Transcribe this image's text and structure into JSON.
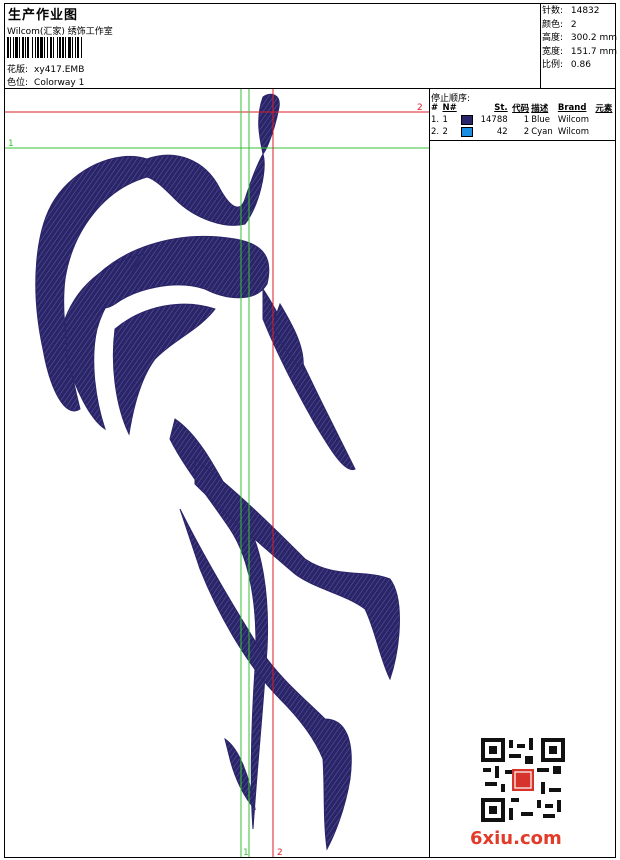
{
  "header": {
    "title": "生产作业图",
    "company": "Wilcom(汇家) 绣饰工作室",
    "design_label": "花版:",
    "design_value": "xy417.EMB",
    "colorway_label": "色位:",
    "colorway_value": "Colorway 1"
  },
  "stats": [
    {
      "label": "针数:",
      "value": "14832"
    },
    {
      "label": "颜色:",
      "value": "2"
    },
    {
      "label": "高度:",
      "value": "300.2 mm"
    },
    {
      "label": "宽度:",
      "value": "151.7 mm"
    },
    {
      "label": "比例:",
      "value": "0.86"
    }
  ],
  "color_table": {
    "title": "停止顺序:",
    "headers": [
      "#",
      "N#",
      "St.",
      "代码",
      "描述",
      "Brand",
      "元素"
    ],
    "rows": [
      {
        "idx": "1.",
        "num": "1",
        "color": "#2a2469",
        "stitches": "14788",
        "code": "1",
        "desc": "Blue",
        "brand": "Wilcom"
      },
      {
        "idx": "2.",
        "num": "2",
        "color": "#1a8ee0",
        "stitches": "42",
        "code": "2",
        "desc": "Cyan",
        "brand": "Wilcom"
      }
    ]
  },
  "guides": {
    "red_label_h": "2",
    "red_label_v": "2",
    "green_label_h": "1",
    "green_label_v": "1"
  },
  "colors": {
    "thread_blue": "#2a2469",
    "guide_red": "#d81e2a",
    "guide_green": "#34c234"
  },
  "watermark": {
    "text": "6xiu.com"
  }
}
